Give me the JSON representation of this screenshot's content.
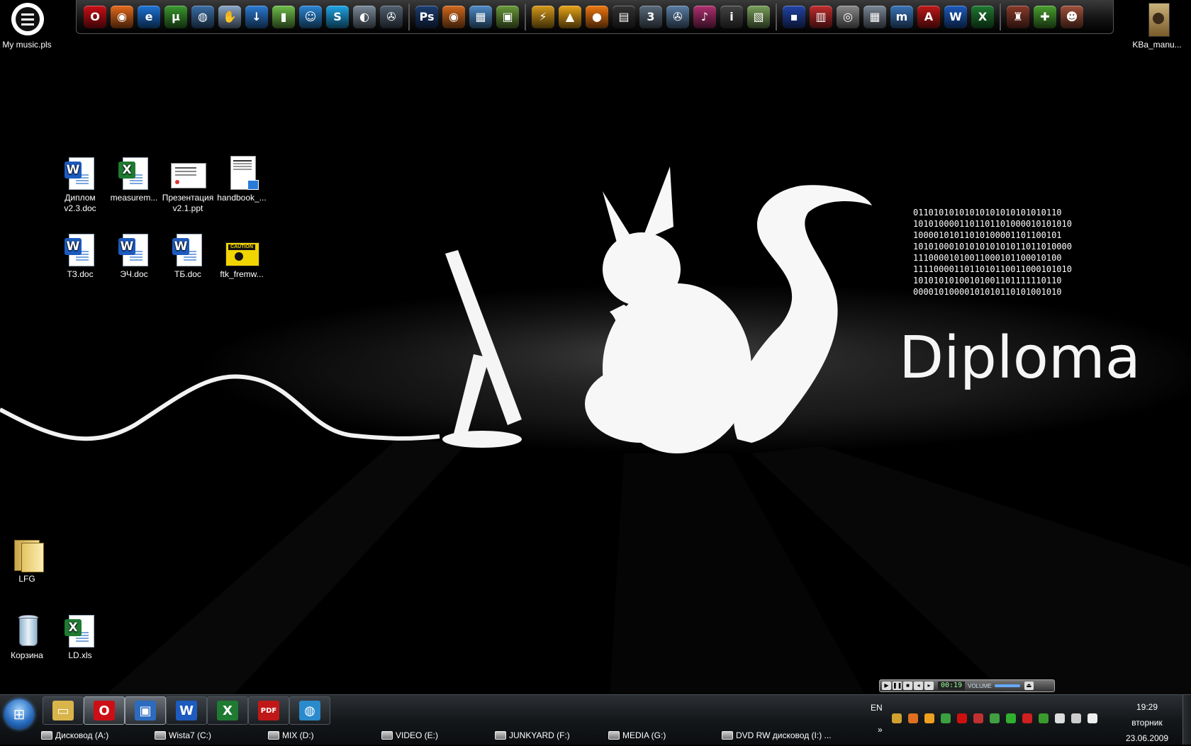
{
  "top_dock": {
    "groups": [
      [
        {
          "name": "opera-icon",
          "color": "#cc0f16",
          "glyph": "O"
        },
        {
          "name": "firefox-icon",
          "color": "#e66a1c",
          "glyph": "◉"
        },
        {
          "name": "internet-explorer-icon",
          "color": "#1c74d8",
          "glyph": "e"
        },
        {
          "name": "utorrent-icon",
          "color": "#3a9a2e",
          "glyph": "µ"
        },
        {
          "name": "network-globe-icon",
          "color": "#3b6ea5",
          "glyph": "◍"
        },
        {
          "name": "hand-connect-icon",
          "color": "#8aa6c8",
          "glyph": "✋"
        },
        {
          "name": "download-arrow-icon",
          "color": "#2b7bd4",
          "glyph": "↓"
        },
        {
          "name": "signal-bars-icon",
          "color": "#6fbf4a",
          "glyph": "▮"
        },
        {
          "name": "messenger-users-icon",
          "color": "#2b86d6",
          "glyph": "☺"
        },
        {
          "name": "skype-icon",
          "color": "#1fa6e8",
          "glyph": "S"
        },
        {
          "name": "headset-icon",
          "color": "#7a8a99",
          "glyph": "◐"
        },
        {
          "name": "media-reel-icon",
          "color": "#506070",
          "glyph": "✇"
        }
      ],
      [
        {
          "name": "photoshop-icon",
          "color": "#1c3d72",
          "glyph": "Ps"
        },
        {
          "name": "image-viewer-eye-icon",
          "color": "#d2691e",
          "glyph": "◉"
        },
        {
          "name": "photo-gallery-icon",
          "color": "#4f8cc9",
          "glyph": "▦"
        },
        {
          "name": "image-tool-icon",
          "color": "#6a9a3a",
          "glyph": "▣"
        }
      ],
      [
        {
          "name": "winamp-icon",
          "color": "#d69a1a",
          "glyph": "⚡"
        },
        {
          "name": "aimp-icon",
          "color": "#e8a417",
          "glyph": "▲"
        },
        {
          "name": "media-orb-icon",
          "color": "#f07810",
          "glyph": "●"
        },
        {
          "name": "video-clapper-icon",
          "color": "#333333",
          "glyph": "▤"
        },
        {
          "name": "counter-321-icon",
          "color": "#5a6b7c",
          "glyph": "3"
        },
        {
          "name": "film-reel-icon",
          "color": "#5b7fa6",
          "glyph": "✇"
        },
        {
          "name": "music-piano-icon",
          "color": "#b03070",
          "glyph": "♪"
        },
        {
          "name": "info-icon",
          "color": "#444444",
          "glyph": "i"
        },
        {
          "name": "map-icon",
          "color": "#7aa05a",
          "glyph": "▧"
        }
      ],
      [
        {
          "name": "save-floppy-icon",
          "color": "#2344a8",
          "glyph": "▪"
        },
        {
          "name": "nero-burn-icon",
          "color": "#c22d2d",
          "glyph": "▥"
        },
        {
          "name": "disc-icon",
          "color": "#8a8a8a",
          "glyph": "◎"
        },
        {
          "name": "calculator-icon",
          "color": "#7a8796",
          "glyph": "▦"
        },
        {
          "name": "mathcad-icon",
          "color": "#3a74b8",
          "glyph": "m"
        },
        {
          "name": "acrobat-icon",
          "color": "#c01818",
          "glyph": "A"
        },
        {
          "name": "word-icon",
          "color": "#1d5bbf",
          "glyph": "W"
        },
        {
          "name": "excel-icon",
          "color": "#1f7a32",
          "glyph": "X"
        }
      ],
      [
        {
          "name": "game-castle-icon",
          "color": "#8a3a2a",
          "glyph": "♜"
        },
        {
          "name": "add-cross-icon",
          "color": "#4aa030",
          "glyph": "✚"
        },
        {
          "name": "game-character-icon",
          "color": "#a0503a",
          "glyph": "☻"
        }
      ]
    ]
  },
  "desktop_icons": {
    "my_music": "My music.pls",
    "kva_manual": "KBa_manu...",
    "diplom": "Диплом v2.3.doc",
    "measurem": "measurem...",
    "prezentaciya": "Презентация v2.1.ppt",
    "handbook": "handbook_...",
    "tz": "ТЗ.doc",
    "ech": "ЭЧ.doc",
    "tb": "ТБ.doc",
    "ftk": "ftk_fremw...",
    "ftk_caution": "CAUTION",
    "lfg": "LFG",
    "korzina": "Корзина",
    "ld": "LD.xls"
  },
  "wallpaper": {
    "title": "Diploma",
    "binary_lines": [
      "01101010101010101010101010110",
      "1010100001101101101000010101010",
      "10000101011010100001101100101",
      "1010100010101010101011011010000",
      "11100001010011000101100010100",
      "1111000011011010110011000101010",
      "10101010100101001101111110110",
      "00001010000101010110101001010"
    ]
  },
  "media_bar": {
    "time": "00:19",
    "volume_label": "VOLUME"
  },
  "taskbar": {
    "pinned": [
      {
        "name": "explorer-folder-icon",
        "color": "#d8b44a",
        "glyph": "▭",
        "active": false
      },
      {
        "name": "opera-icon",
        "color": "#cc0f16",
        "glyph": "O",
        "active": true
      },
      {
        "name": "window-app-icon",
        "color": "#2d6bbf",
        "glyph": "▣",
        "active": true
      },
      {
        "name": "word-icon",
        "color": "#1d5bbf",
        "glyph": "W",
        "active": false
      },
      {
        "name": "excel-icon",
        "color": "#1f7a32",
        "glyph": "X",
        "active": false
      },
      {
        "name": "pdf-icon",
        "color": "#c01818",
        "glyph": "PDF",
        "active": false
      },
      {
        "name": "globe-app-icon",
        "color": "#2a8acc",
        "glyph": "◍",
        "active": false
      }
    ],
    "drives": [
      "Дисковод (A:)",
      "Wista7 (C:)",
      "MIX (D:)",
      "VIDEO (E:)",
      "JUNKYARD (F:)",
      "MEDIA (G:)",
      "DVD RW дисковод (I:) ..."
    ],
    "language": "EN",
    "chevron": "»",
    "tray_icons": [
      {
        "name": "network-tray-icon",
        "color": "#d0a030"
      },
      {
        "name": "media-player-tray-icon",
        "color": "#e07020"
      },
      {
        "name": "folder-tray-icon",
        "color": "#f0a020"
      },
      {
        "name": "usb-tray-icon",
        "color": "#3aa040"
      },
      {
        "name": "opera-tray-icon",
        "color": "#cc1010"
      },
      {
        "name": "tools-tray-icon",
        "color": "#c03030"
      },
      {
        "name": "puzzle-tray-icon",
        "color": "#40a040"
      },
      {
        "name": "check-tray-icon",
        "color": "#30b030"
      },
      {
        "name": "warning-tray-icon",
        "color": "#d02020"
      },
      {
        "name": "utorrent-tray-icon",
        "color": "#3a9a2e"
      },
      {
        "name": "flag-tray-icon",
        "color": "#dddddd"
      },
      {
        "name": "monitor-tray-icon",
        "color": "#cccccc"
      },
      {
        "name": "volume-tray-icon",
        "color": "#eeeeee"
      }
    ],
    "time": "19:29",
    "day": "вторник",
    "date": "23.06.2009"
  }
}
